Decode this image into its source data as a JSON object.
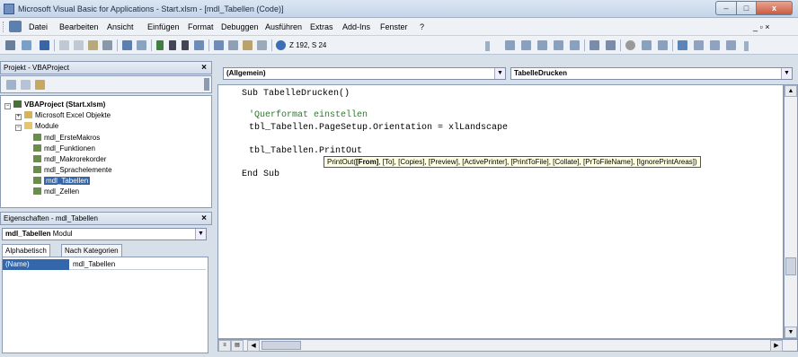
{
  "window": {
    "title": "Microsoft Visual Basic for Applications - Start.xlsm - [mdl_Tabellen (Code)]",
    "controls": {
      "minimize": "–",
      "maximize": "□",
      "close": "x"
    }
  },
  "menubar": {
    "items": [
      "Datei",
      "Bearbeiten",
      "Ansicht",
      "Einfügen",
      "Format",
      "Debuggen",
      "Ausführen",
      "Extras",
      "Add-Ins",
      "Fenster",
      "?"
    ],
    "mdi_controls": "_ ▫ ×"
  },
  "toolbar": {
    "position_label": "Z 192, S 24"
  },
  "project_panel": {
    "title": "Projekt - VBAProject",
    "root": "VBAProject (Start.xlsm)",
    "folders": [
      "Microsoft Excel Objekte",
      "Module"
    ],
    "modules": [
      "mdl_ErsteMakros",
      "mdl_Funktionen",
      "mdl_Makrorekorder",
      "mdl_Sprachelemente",
      "mdl_Tabellen",
      "mdl_Zellen"
    ],
    "selected_module": "mdl_Tabellen"
  },
  "properties_panel": {
    "title": "Eigenschaften - mdl_Tabellen",
    "object_name": "mdl_Tabellen",
    "object_type": "Modul",
    "tabs": [
      "Alphabetisch",
      "Nach Kategorien"
    ],
    "property_name": "(Name)",
    "property_value": "mdl_Tabellen"
  },
  "code_window": {
    "object_combo": "(Allgemein)",
    "procedure_combo": "TabelleDrucken",
    "lines": [
      {
        "text": "Sub TabelleDrucken()",
        "type": "code"
      },
      {
        "text": "",
        "type": "code"
      },
      {
        "text": "'Querformat einstellen",
        "type": "comment"
      },
      {
        "text": "tbl_Tabellen.PageSetup.Orientation = xlLandscape",
        "type": "code"
      },
      {
        "text": "",
        "type": "code"
      },
      {
        "text": "tbl_Tabellen.PrintOut",
        "type": "code"
      },
      {
        "text": "End Sub",
        "type": "code"
      }
    ],
    "tooltip_prefix": "PrintOut(",
    "tooltip_bold": "[From]",
    "tooltip_rest": ", [To], [Copies], [Preview], [ActivePrinter], [PrintToFile], [Collate], [PrToFileName], [IgnorePrintAreas])"
  }
}
